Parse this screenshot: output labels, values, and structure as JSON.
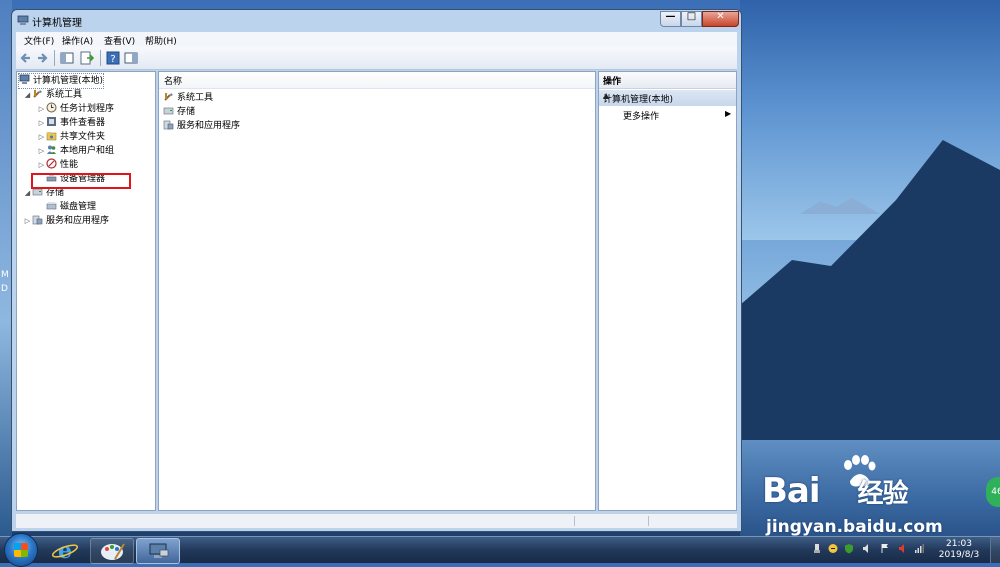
{
  "window": {
    "title": "计算机管理",
    "controls": {
      "minimize": "—",
      "maximize": "□",
      "close": "✕"
    }
  },
  "menu": {
    "file": "文件(F)",
    "action": "操作(A)",
    "view": "查看(V)",
    "help": "帮助(H)"
  },
  "tree": {
    "root": "计算机管理(本地)",
    "system_tools": "系统工具",
    "task_scheduler": "任务计划程序",
    "event_viewer": "事件查看器",
    "shared_folders": "共享文件夹",
    "local_users": "本地用户和组",
    "performance": "性能",
    "device_manager": "设备管理器",
    "storage": "存储",
    "disk_management": "磁盘管理",
    "services_apps": "服务和应用程序"
  },
  "list": {
    "column_name": "名称",
    "items": [
      "系统工具",
      "存储",
      "服务和应用程序"
    ]
  },
  "actions": {
    "header": "操作",
    "section": "计算机管理(本地)",
    "more": "更多操作"
  },
  "desktop": {
    "left_text_1": "M",
    "left_text_2": "D",
    "watermark_brand": "Bai",
    "watermark_brand_2": "经验",
    "watermark_url": "jingyan.baidu.com",
    "badge": "46"
  },
  "taskbar": {
    "time": "21:03",
    "date": "2019/8/3"
  },
  "colors": {
    "highlight_box": "#e0141b",
    "window_frame": "#bcd3ee",
    "taskbar": "#22395a"
  }
}
